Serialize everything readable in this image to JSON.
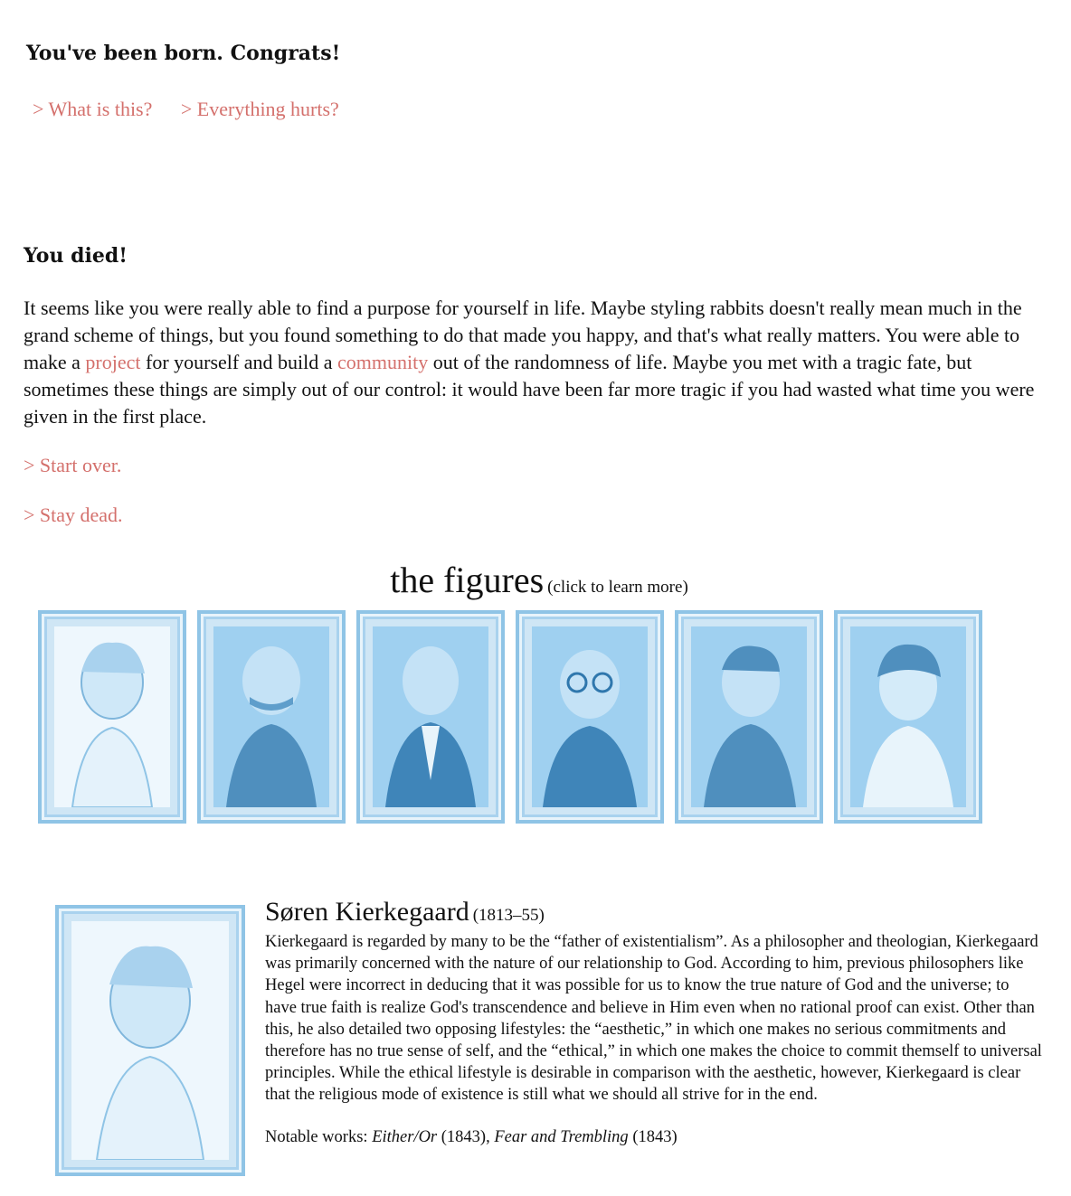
{
  "top": {
    "heading": "You've been born. Congrats!",
    "choices": [
      "> What is this?",
      "> Everything hurts?"
    ]
  },
  "ending": {
    "heading": "You died!",
    "text_1": "It seems like you were really able to find a purpose for yourself in life. Maybe styling rabbits doesn't really mean much in the grand scheme of things, but you found something to do that made you happy, and that's what really matters. You were able to make a ",
    "link_project": "project",
    "text_2": " for yourself and build a ",
    "link_community": "community",
    "text_3": " out of the randomness of life. Maybe you met with a tragic fate, but sometimes these things are simply out of our control: it would have been far more tragic if you had wasted what time you were given in the first place.",
    "start_over": "> Start over.",
    "stay_dead": "> Stay dead."
  },
  "figures": {
    "title": "the figures",
    "hint": "(click to learn more)"
  },
  "selected": {
    "name": "Søren Kierkegaard",
    "years": "(1813–55)",
    "bio": "Kierkegaard is regarded by many to be the “father of existentialism”. As a philosopher and theologian, Kierkegaard was primarily concerned with the nature of our relationship to God. According to him, previous philosophers like Hegel were incorrect in deducing that it was possible for us to know the true nature of God and the universe; to have true faith is realize God's transcendence and believe in Him even when no rational proof can exist. Other than this, he also detailed two opposing lifestyles: the “aesthetic,” in which one makes no serious commitments and therefore has no true sense of self, and the “ethical,” in which one makes the choice to commit themself to universal principles. While the ethical lifestyle is desirable in comparison with the aesthetic, however, Kierkegaard is clear that the religious mode of existence is still what we should all strive for in the end.",
    "works_label": "Notable works: ",
    "work_1": "Either/Or",
    "work_1_year": " (1843), ",
    "work_2": "Fear and Trembling",
    "work_2_year": " (1843)"
  },
  "colors": {
    "link": "#d4706c",
    "frame": "#8fc4e6",
    "portrait": "#9fd0f0"
  }
}
